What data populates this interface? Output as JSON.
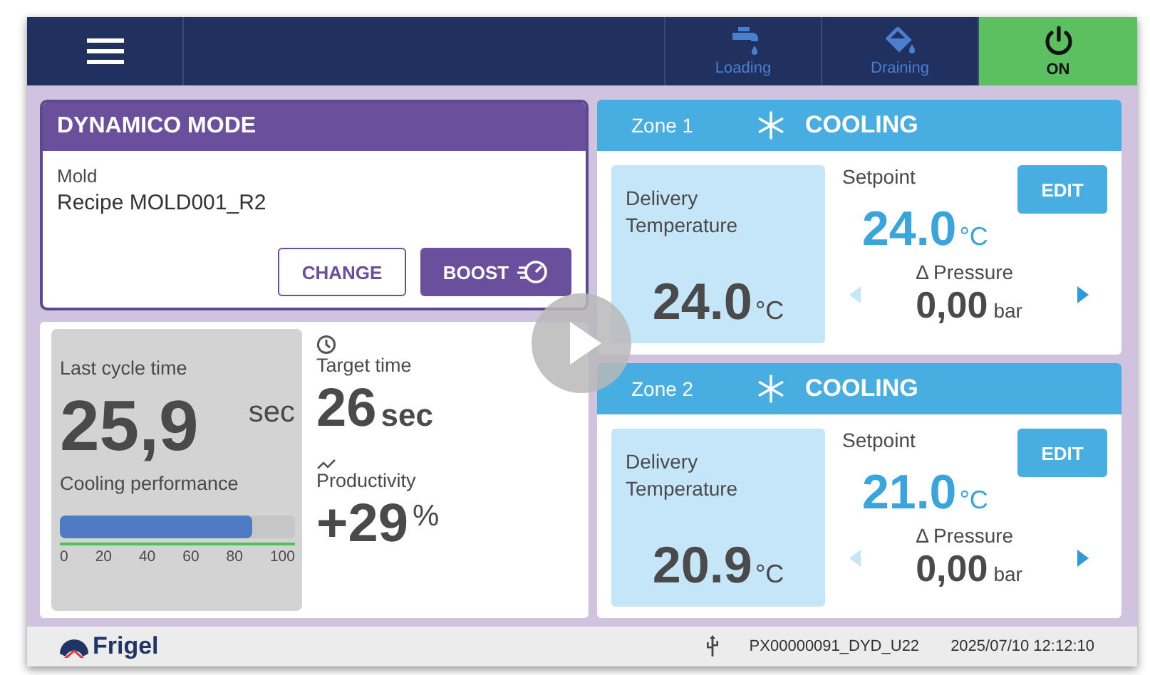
{
  "top_bar": {
    "items": [
      {
        "kind": "faucet",
        "label": "Loading",
        "active": false
      },
      {
        "kind": "bucket",
        "label": "Draining",
        "active": false
      },
      {
        "kind": "power",
        "label": "ON",
        "active": true
      }
    ]
  },
  "mode_card": {
    "title": "DYNAMICO MODE",
    "field_label": "Mold",
    "value": "Recipe MOLD001_R2",
    "buttons": [
      {
        "kind": "outline",
        "label": "CHANGE"
      },
      {
        "kind": "boost",
        "label": "BOOST"
      }
    ]
  },
  "stats": {
    "last_cycle": {
      "label": "Last cycle time",
      "value": "25,9",
      "unit": "sec"
    },
    "cooling_performance": {
      "label": "Cooling performance",
      "level": 0.82,
      "scale": [
        "0",
        "20",
        "40",
        "60",
        "80",
        "100"
      ]
    },
    "target_time": {
      "label": "Target time",
      "value": "26",
      "unit": "sec"
    },
    "productivity": {
      "label": "Productivity",
      "value": "+29",
      "unit": "%"
    }
  },
  "zones": [
    {
      "name": "Zone 1",
      "status": "COOLING",
      "delivery_label": "Delivery Temperature",
      "delivery_value": "24.0",
      "delivery_unit": "°C",
      "setpoint_label": "Setpoint",
      "setpoint_value": "24.0",
      "setpoint_unit": "°C",
      "edit": "EDIT",
      "pressure_label": "Δ Pressure",
      "pressure_value": "0,00",
      "pressure_unit": "bar"
    },
    {
      "name": "Zone 2",
      "status": "COOLING",
      "delivery_label": "Delivery Temperature",
      "delivery_value": "20.9",
      "delivery_unit": "°C",
      "setpoint_label": "Setpoint",
      "setpoint_value": "21.0",
      "setpoint_unit": "°C",
      "edit": "EDIT",
      "pressure_label": "Δ Pressure",
      "pressure_value": "0,00",
      "pressure_unit": "bar"
    }
  ],
  "status_bar": {
    "logo": "Frigel",
    "device": "PX00000091_DYD_U22",
    "datetime": "2025/07/10 12:12:10"
  }
}
